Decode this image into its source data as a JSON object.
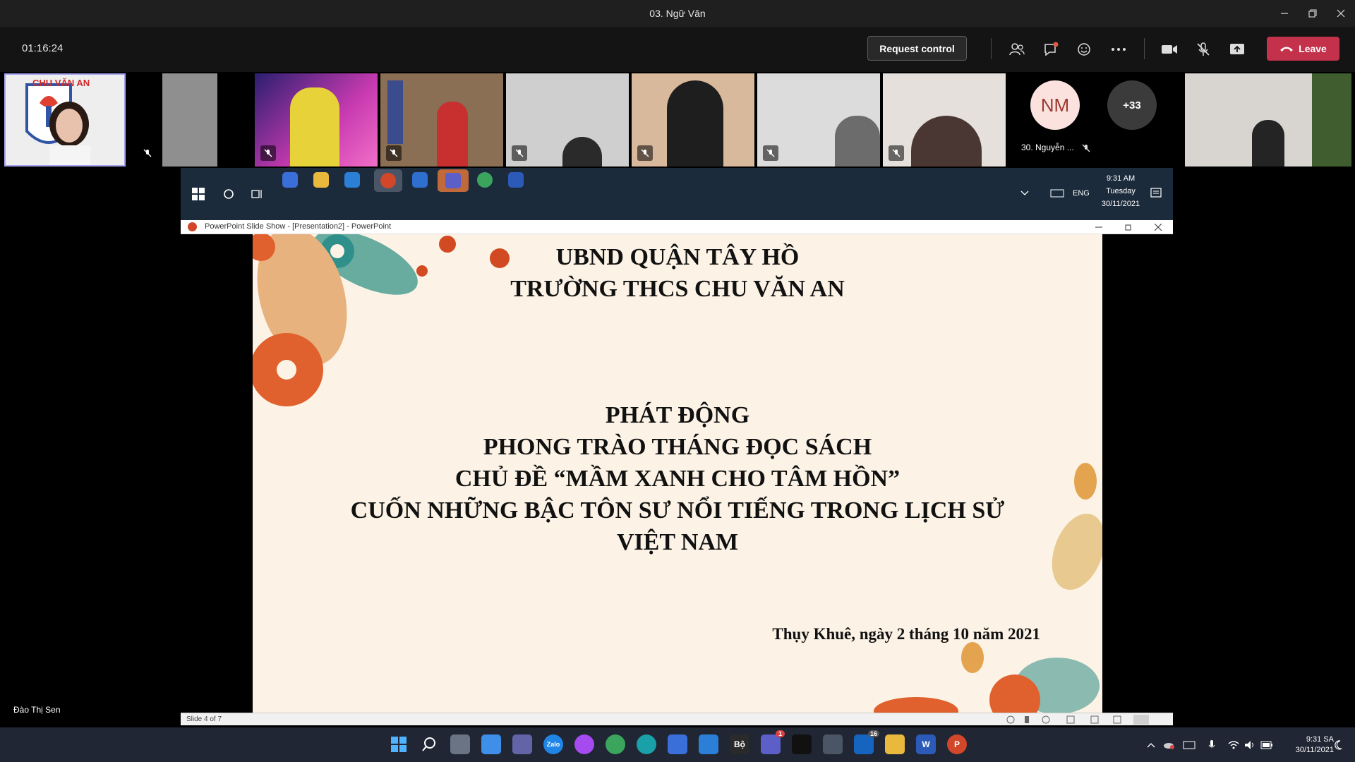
{
  "window": {
    "title": "03. Ngữ Văn"
  },
  "meeting": {
    "timer": "01:16:24",
    "request_control_label": "Request control",
    "leave_label": "Leave"
  },
  "participants": {
    "logo_text": "CHU VĂN AN",
    "named_tile": {
      "initials": "NM",
      "name": "30. Nguyễn ..."
    },
    "overflow_count": "+33"
  },
  "shared_screen": {
    "taskbar": {
      "time": "9:31 AM",
      "day": "Tuesday",
      "date": "30/11/2021",
      "lang": "ENG"
    },
    "ppt_title": "PowerPoint Slide Show - [Presentation2] - PowerPoint",
    "slide": {
      "header_line1": "UBND QUẬN TÂY HỒ",
      "header_line2": "TRƯỜNG THCS CHU VĂN AN",
      "body_line1": "PHÁT ĐỘNG",
      "body_line2": "PHONG TRÀO THÁNG ĐỌC SÁCH",
      "body_line3": "CHỦ ĐỀ “MẦM XANH CHO TÂM HỒN”",
      "body_line4": "CUỐN NHỮNG BẬC TÔN SƯ NỔI TIẾNG TRONG LỊCH SỬ",
      "body_line5": "VIỆT NAM",
      "date_line": "Thụy Khuê, ngày 2 tháng 10 năm 2021"
    },
    "status": "Slide 4 of 7"
  },
  "presenter_name": "Đào Thị Sen",
  "taskbar": {
    "time": "9:31 SA",
    "date": "30/11/2021",
    "teams_badge": "1",
    "mail_badge": "16"
  },
  "colors": {
    "leave": "#c4314b",
    "accent_tile_border": "#a4a4f0",
    "avatar_bg": "#fbe2de",
    "avatar_text": "#9c3a2f"
  }
}
